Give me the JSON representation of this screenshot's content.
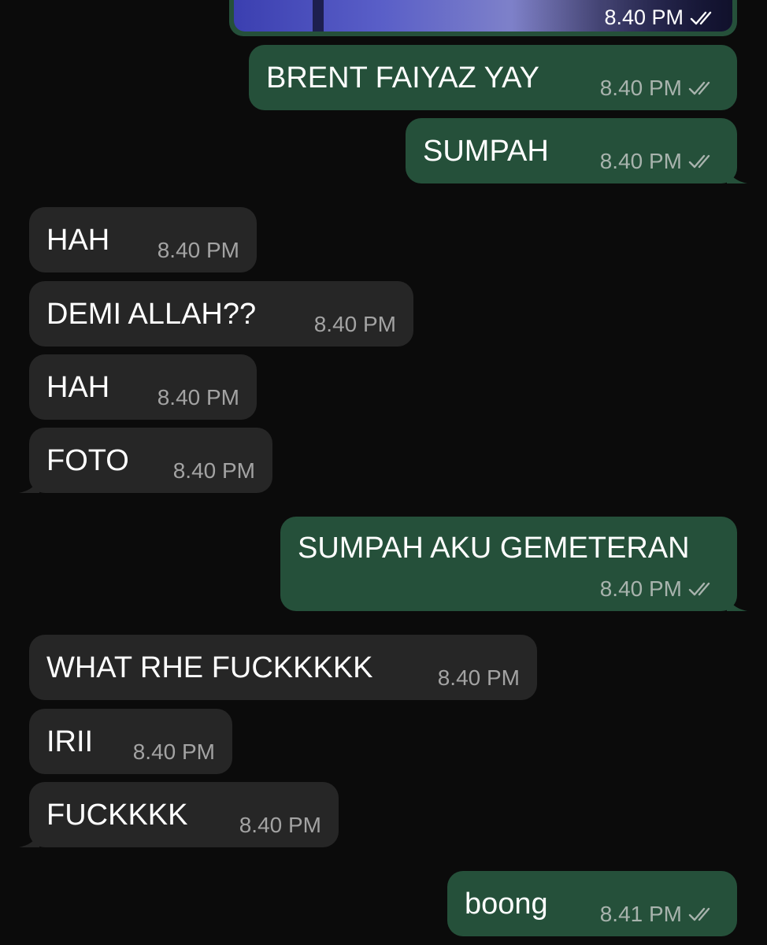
{
  "messages": [
    {
      "direction": "out",
      "type": "photo",
      "time": "8.40 PM",
      "status": "read"
    },
    {
      "direction": "out",
      "text": "BRENT FAIYAZ YAY",
      "time": "8.40 PM",
      "status": "read"
    },
    {
      "direction": "out",
      "text": "SUMPAH",
      "time": "8.40 PM",
      "status": "read"
    },
    {
      "direction": "in",
      "text": "HAH",
      "time": "8.40 PM"
    },
    {
      "direction": "in",
      "text": "DEMI ALLAH??",
      "time": "8.40 PM"
    },
    {
      "direction": "in",
      "text": "HAH",
      "time": "8.40 PM"
    },
    {
      "direction": "in",
      "text": "FOTO",
      "time": "8.40 PM"
    },
    {
      "direction": "out",
      "text": "SUMPAH AKU GEMETERAN",
      "time": "8.40 PM",
      "status": "read"
    },
    {
      "direction": "in",
      "text": "WHAT RHE FUCKKKKK",
      "time": "8.40 PM"
    },
    {
      "direction": "in",
      "text": "IRII",
      "time": "8.40 PM"
    },
    {
      "direction": "in",
      "text": "FUCKKKK",
      "time": "8.40 PM"
    },
    {
      "direction": "out",
      "text": "boong",
      "time": "8.41 PM",
      "status": "read"
    }
  ],
  "icons": {
    "read_receipt": "double-check-icon"
  },
  "colors": {
    "background": "#0b0b0b",
    "outgoing_bubble": "#25503a",
    "incoming_bubble": "#262626",
    "timestamp": "#a8b3ad"
  }
}
